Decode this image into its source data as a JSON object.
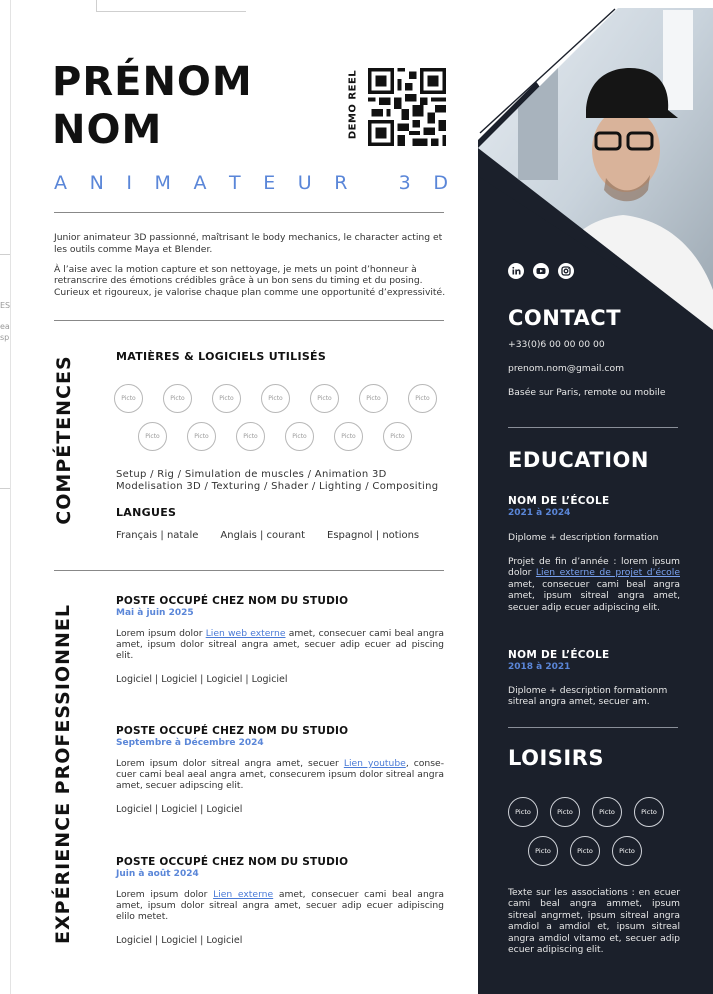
{
  "header": {
    "first_name": "PRÉNOM",
    "last_name": "NOM",
    "job_title": "ANIMATEUR 3D",
    "qr_label": "DEMO REEL"
  },
  "edge_fragments": [
    "ES",
    "ea",
    "sp"
  ],
  "intro": [
    "Junior animateur 3D passionné, maîtrisant le body mechanics, le character acting et les outils comme Maya et Blender.",
    "À l’aise avec la motion capture et son nettoyage, je mets un point d’honneur à retranscrire des émotions crédibles grâce à un bon sens du timing et du posing. Curieux et rigoureux, je valorise chaque plan comme une opportunité d’expressivité."
  ],
  "skills": {
    "title": "COMPÉTENCES",
    "tools_heading": "MATIÈRES & LOGICIELS UTILISÉS",
    "picto_label": "Picto",
    "skills_line1": "Setup / Rig / Simulation de muscles / Animation 3D",
    "skills_line2": "Modelisation 3D / Texturing / Shader / Lighting  / Compositing",
    "languages_heading": "LANGUES",
    "languages": [
      "Français | natale",
      "Anglais | courant",
      "Espagnol | notions"
    ]
  },
  "experience": {
    "title": "EXPÉRIENCE PROFESSIONNEL",
    "items": [
      {
        "title": "POSTE OCCUPÉ CHEZ NOM DU STUDIO",
        "dates": "Mai à juin 2025",
        "before": "Lorem ipsum dolor ",
        "link": "Lien web externe",
        "after": " amet, consecuer cami beal angra amet,  ipsum dolor sitreal angra amet, secuer adip ecuer ad piscing elit.",
        "software": "Logiciel | Logiciel | Logiciel | Logiciel"
      },
      {
        "title": "POSTE OCCUPÉ CHEZ NOM DU STUDIO",
        "dates": "Septembre à Décembre 2024",
        "before": "Lorem ipsum dolor sitreal angra amet, secuer ",
        "link": "Lien youtube",
        "after": ", conse-cuer cami beal aeal angra amet, consecurem ipsum dolor sitreal angra amet, secuer adipscing elit.",
        "software": "Logiciel | Logiciel | Logiciel"
      },
      {
        "title": "POSTE OCCUPÉ CHEZ NOM DU STUDIO",
        "dates": "Juin à août 2024",
        "before": "Lorem ipsum dolor ",
        "link": "Lien externe",
        "after": " amet, consecuer cami beal angra amet,  ipsum dolor sitreal angra amet, secuer adip ecuer adipiscing elilo metet.",
        "software": "Logiciel | Logiciel  | Logiciel"
      }
    ]
  },
  "contact": {
    "title": "CONTACT",
    "phone": "+33(0)6 00 00 00 00",
    "email": "prenom.nom@gmail.com",
    "location": "Basée sur Paris, remote ou mobile",
    "social_icons": [
      "linkedin-icon",
      "youtube-icon",
      "instagram-icon"
    ]
  },
  "education": {
    "title": "EDUCATION",
    "schools": [
      {
        "name": "NOM DE L’ÉCOLE",
        "years": "2021 à 2024",
        "degree": "Diplome + description formation",
        "project_before": "Projet de fin d’année : lorem ipsum dolor ",
        "project_link": "Lien externe de projet d’école",
        "project_after": " amet, consecuer cami beal angra amet,  ipsum sitreal angra amet, secuer adip ecuer adipiscing elit."
      },
      {
        "name": "NOM DE L’ÉCOLE",
        "years": "2018 à 2021",
        "degree": "Diplome + description formationm sitreal angra amet, secuer am."
      }
    ]
  },
  "hobbies": {
    "title": "LOISIRS",
    "picto_label": "Picto",
    "text": "Texte sur les associations : en ecuer cami beal angra ammet,  ipsum sitreal angrmet,   ipsum sitreal angra amdiol a amdiol et,  ipsum sitreal angra amdiol   vitamo et, secuer adip ecuer adipiscing elit."
  },
  "colors": {
    "accent": "#5a86d8",
    "dark_panel": "#1b202b",
    "link": "#4a7ad6"
  }
}
